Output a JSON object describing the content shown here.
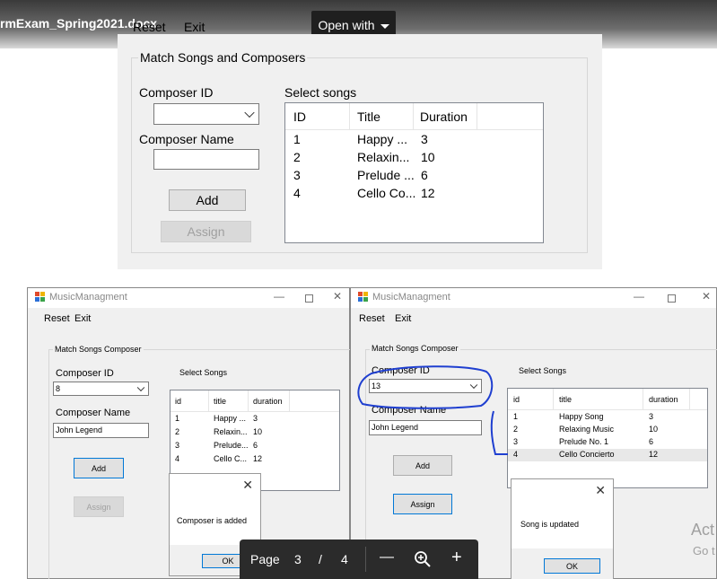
{
  "viewer": {
    "filename": "rmExam_Spring2021.docx",
    "open_with": "Open with",
    "pager": {
      "page_label": "Page",
      "current": "3",
      "sep": "/",
      "total": "4",
      "zoom_out": "—",
      "zoom_in": "+"
    },
    "watermark": {
      "line1": "Act",
      "line2": "Go t"
    }
  },
  "form1": {
    "menu": {
      "reset": "Reset",
      "exit": "Exit"
    },
    "group_title": "Match Songs and Composers",
    "composer_id_label": "Composer ID",
    "composer_id_value": "",
    "composer_name_label": "Composer Name",
    "composer_name_value": "",
    "add": "Add",
    "assign": "Assign",
    "select_songs_label": "Select songs",
    "columns": [
      "ID",
      "Title",
      "Duration"
    ],
    "rows": [
      [
        "1",
        "Happy ...",
        "3"
      ],
      [
        "2",
        "Relaxin...",
        "10"
      ],
      [
        "3",
        "Prelude ...",
        "6"
      ],
      [
        "4",
        "Cello Co...",
        "12"
      ]
    ]
  },
  "win_left": {
    "title": "MusicManagment",
    "menu": {
      "reset": "Reset",
      "exit": "Exit"
    },
    "group_title": "Match Songs  Composer",
    "composer_id_label": "Composer ID",
    "composer_id_value": "8",
    "composer_name_label": "Composer Name",
    "composer_name_value": "John Legend",
    "add": "Add",
    "assign": "Assign",
    "select_songs_label": "Select Songs",
    "columns": [
      "id",
      "title",
      "duration"
    ],
    "rows": [
      [
        "1",
        "Happy ...",
        "3"
      ],
      [
        "2",
        "Relaxin...",
        "10"
      ],
      [
        "3",
        "Prelude...",
        "6"
      ],
      [
        "4",
        "Cello C...",
        "12"
      ]
    ],
    "message": {
      "text": "Composer is added",
      "ok": "OK"
    }
  },
  "win_right": {
    "title": "MusicManagment",
    "menu": {
      "reset": "Reset",
      "exit": "Exit"
    },
    "group_title": "Match Songs  Composer",
    "composer_id_label": "Composer ID",
    "composer_id_value": "13",
    "composer_name_label": "Composer Name",
    "composer_name_value": "John Legend",
    "add": "Add",
    "assign": "Assign",
    "select_songs_label": "Select Songs",
    "columns": [
      "id",
      "title",
      "duration"
    ],
    "rows": [
      [
        "1",
        "Happy Song",
        "3"
      ],
      [
        "2",
        "Relaxing Music",
        "10"
      ],
      [
        "3",
        "Prelude No. 1",
        "6"
      ],
      [
        "4",
        "Cello Concierto",
        "12"
      ]
    ],
    "message": {
      "text": "Song is updated",
      "ok": "OK"
    }
  },
  "colors": {
    "annotation": "#1f3fd0",
    "focus": "#0078d7",
    "viewer_bar": "#2b2b2b"
  }
}
